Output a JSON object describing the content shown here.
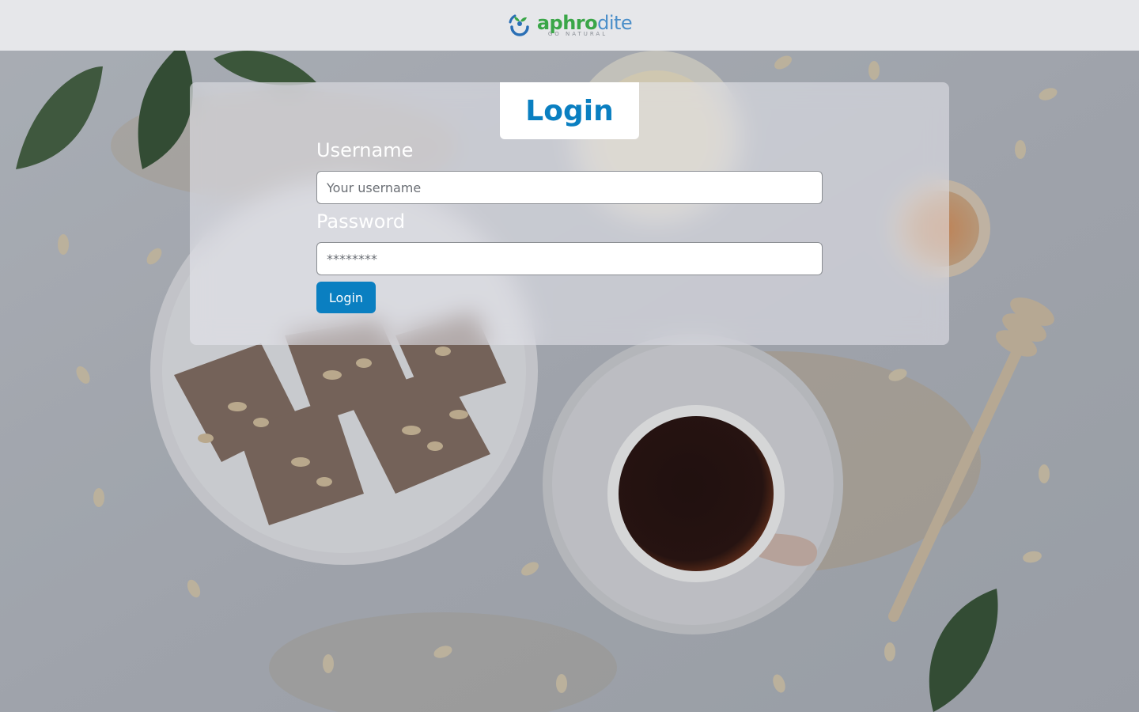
{
  "header": {
    "logo": {
      "word_bold": "aphro",
      "word_light": "dite",
      "tagline": "GO NATURAL"
    }
  },
  "login_form": {
    "title": "Login",
    "username": {
      "label": "Username",
      "placeholder": "Your username",
      "value": ""
    },
    "password": {
      "label": "Password",
      "placeholder": "********",
      "value": ""
    },
    "submit_label": "Login"
  },
  "colors": {
    "accent": "#0a7fc1",
    "header_bg": "#e6e7ea",
    "logo_green": "#3aa648",
    "logo_blue": "#4a8ec9"
  }
}
